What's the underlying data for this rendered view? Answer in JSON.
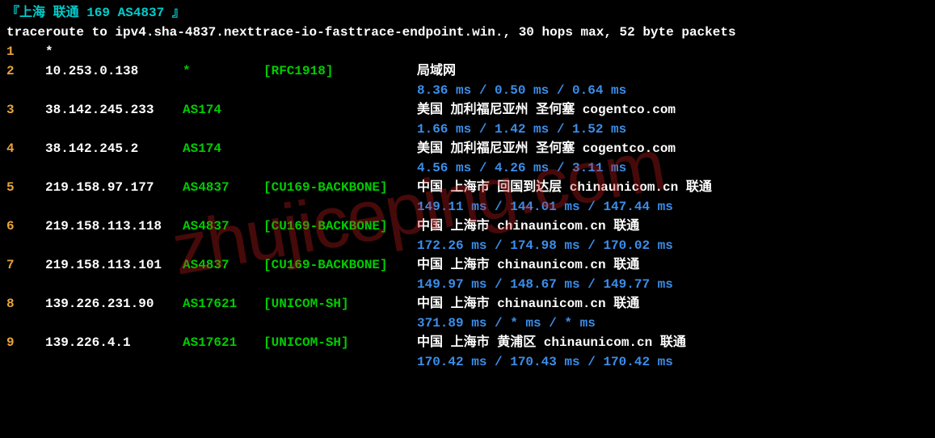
{
  "header": "『上海 联通 169 AS4837 』",
  "subheader": "traceroute to ipv4.sha-4837.nexttrace-io-fasttrace-endpoint.win., 30 hops max, 52 byte packets",
  "hops": [
    {
      "n": "1",
      "ip": "*",
      "as": "",
      "label": "",
      "loc": "",
      "lat": ""
    },
    {
      "n": "2",
      "ip": "10.253.0.138",
      "as": "*",
      "label": "[RFC1918]",
      "loc": "局域网",
      "lat": "8.36 ms / 0.50 ms / 0.64 ms"
    },
    {
      "n": "3",
      "ip": "38.142.245.233",
      "as": "AS174",
      "label": "",
      "loc": "美国 加利福尼亚州 圣何塞  cogentco.com",
      "lat": "1.66 ms / 1.42 ms / 1.52 ms"
    },
    {
      "n": "4",
      "ip": "38.142.245.2",
      "as": "AS174",
      "label": "",
      "loc": "美国 加利福尼亚州 圣何塞  cogentco.com",
      "lat": "4.56 ms / 4.26 ms / 3.11 ms"
    },
    {
      "n": "5",
      "ip": "219.158.97.177",
      "as": "AS4837",
      "label": "[CU169-BACKBONE]",
      "loc": "中国 上海市  回国到达层 chinaunicom.cn  联通",
      "lat": "149.11 ms / 144.01 ms / 147.44 ms"
    },
    {
      "n": "6",
      "ip": "219.158.113.118",
      "as": "AS4837",
      "label": "[CU169-BACKBONE]",
      "loc": "中国 上海市  chinaunicom.cn  联通",
      "lat": "172.26 ms / 174.98 ms / 170.02 ms"
    },
    {
      "n": "7",
      "ip": "219.158.113.101",
      "as": "AS4837",
      "label": "[CU169-BACKBONE]",
      "loc": "中国 上海市   chinaunicom.cn  联通",
      "lat": "149.97 ms / 148.67 ms / 149.77 ms"
    },
    {
      "n": "8",
      "ip": "139.226.231.90",
      "as": "AS17621",
      "label": "[UNICOM-SH]",
      "loc": "中国 上海市   chinaunicom.cn  联通",
      "lat": "371.89 ms / * ms / * ms"
    },
    {
      "n": "9",
      "ip": "139.226.4.1",
      "as": "AS17621",
      "label": "[UNICOM-SH]",
      "loc": "中国 上海市  黄浦区 chinaunicom.cn  联通",
      "lat": "170.42 ms / 170.43 ms / 170.42 ms"
    }
  ],
  "watermark": "zhujiceping.com"
}
